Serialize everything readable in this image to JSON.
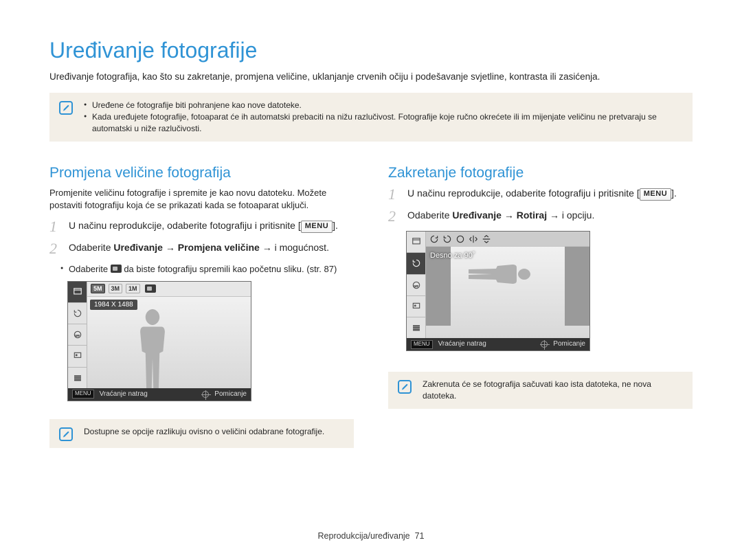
{
  "title": "Uređivanje fotografije",
  "intro": "Uređivanje fotografija, kao što su zakretanje, promjena veličine, uklanjanje crvenih očiju i podešavanje svjetline, kontrasta ili zasićenja.",
  "top_note": {
    "items": [
      "Uređene će fotografije biti pohranjene kao nove datoteke.",
      "Kada uređujete fotografije, fotoaparat će ih automatski prebaciti na nižu razlučivost. Fotografije koje ručno okrećete ili im mijenjate veličinu ne pretvaraju se automatski u niže razlučivosti."
    ]
  },
  "left": {
    "heading": "Promjena veličine fotografija",
    "desc": "Promjenite veličinu fotografije i spremite je kao novu datoteku. Možete postaviti fotografiju koja će se prikazati kada se fotoaparat uključi.",
    "step1_a": "U načinu reprodukcije, odaberite fotografiju i pritisnite ",
    "menu_label": "MENU",
    "step2_a": "Odaberite ",
    "step2_b1": "Uređivanje",
    "step2_arrow": " → ",
    "step2_b2": "Promjena veličine",
    "step2_c": " → i mogućnost.",
    "bullet_a": "Odaberite ",
    "bullet_b": " da biste fotografiju spremili kao početnu sliku. (str. 87)",
    "lcd": {
      "chips": [
        "5M",
        "3M",
        "1M"
      ],
      "res": "1984 X 1488",
      "back": "Vraćanje natrag",
      "move": "Pomicanje"
    },
    "bottom_note": "Dostupne se opcije razlikuju ovisno o veličini odabrane fotografije."
  },
  "right": {
    "heading": "Zakretanje fotografije",
    "step1_a": "U načinu reprodukcije, odaberite fotografiju i pritisnite ",
    "step2_a": "Odaberite ",
    "step2_b1": "Uređivanje",
    "step2_arrow": " → ",
    "step2_b2": "Rotiraj",
    "step2_c": " → i opciju.",
    "lcd": {
      "option": "Desno za 90˚",
      "back": "Vraćanje natrag",
      "move": "Pomicanje"
    },
    "bottom_note": "Zakrenuta će se fotografija sačuvati kao ista datoteka, ne nova datoteka."
  },
  "footer": {
    "section": "Reprodukcija/uređivanje",
    "page": "71"
  }
}
